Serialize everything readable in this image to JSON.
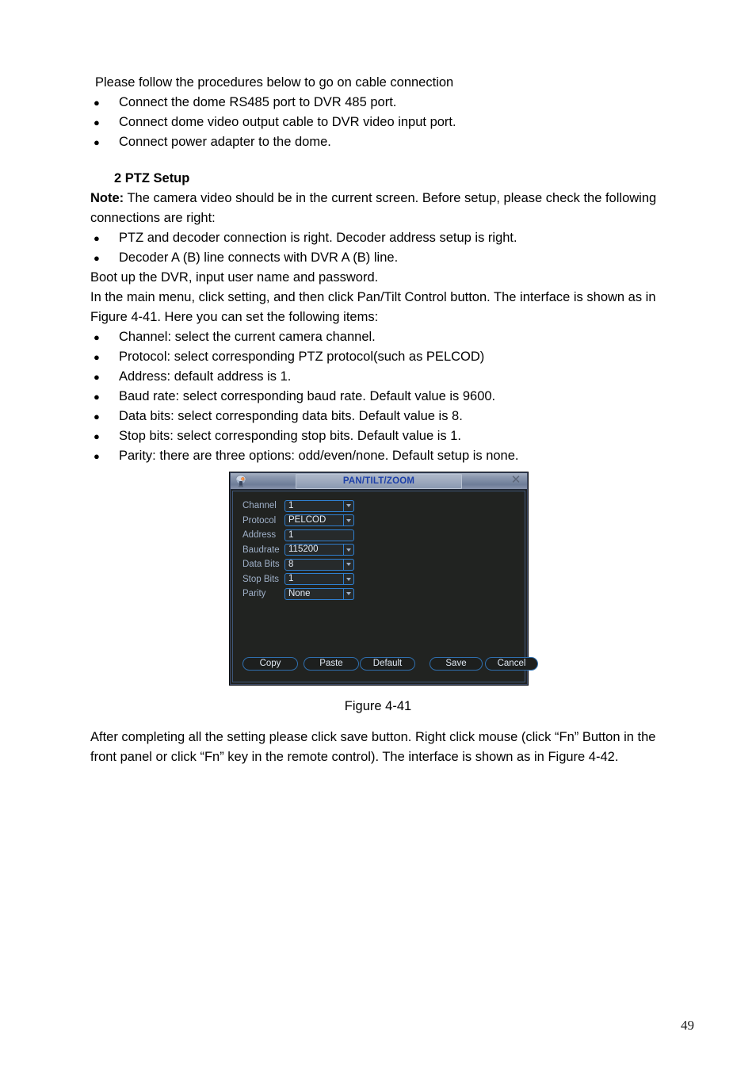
{
  "document": {
    "lead_line": "Please follow the procedures below to go on cable connection",
    "cable_steps": [
      "Connect the dome RS485 port to DVR 485 port.",
      "Connect dome video output cable to DVR video input port.",
      "Connect power adapter to the dome."
    ],
    "section_heading": "2 PTZ Setup",
    "note_label": "Note:",
    "note_text": " The camera video should be in the current screen. Before setup, please check the following connections are right:",
    "check_items": [
      "PTZ and decoder connection is right. Decoder address setup is right.",
      "Decoder A (B) line connects with DVR A (B) line."
    ],
    "boot_line": "Boot up the DVR, input user name and password.",
    "menu_line": "In the main menu, click setting, and then click Pan/Tilt Control button. The interface is shown as in Figure 4-41. Here you can set the following items:",
    "item_list": [
      "Channel: select the current camera channel.",
      "Protocol: select corresponding PTZ protocol(such as PELCOD)",
      "Address: default address is 1.",
      "Baud rate: select corresponding baud rate. Default value is 9600.",
      "Data bits: select corresponding data bits. Default value is 8.",
      "Stop bits: select corresponding stop bits. Default value is 1.",
      "Parity: there are three options: odd/even/none. Default setup is none."
    ],
    "figure_caption": "Figure 4-41",
    "after_text": "After completing all the setting please click save button. Right click mouse (click “Fn” Button in the front panel or click “Fn” key in the remote control). The interface is shown as in Figure 4-42.",
    "page_number": "49"
  },
  "dialog": {
    "title": "PAN/TILT/ZOOM",
    "close_label": "✕",
    "icon_name": "ptz-dome-camera-icon",
    "fields": [
      {
        "label": "Channel",
        "value": "1",
        "control": "dropdown"
      },
      {
        "label": "Protocol",
        "value": "PELCOD",
        "control": "dropdown"
      },
      {
        "label": "Address",
        "value": "1",
        "control": "text"
      },
      {
        "label": "Baudrate",
        "value": "115200",
        "control": "dropdown"
      },
      {
        "label": "Data Bits",
        "value": "8",
        "control": "dropdown"
      },
      {
        "label": "Stop Bits",
        "value": "1",
        "control": "dropdown"
      },
      {
        "label": "Parity",
        "value": "None",
        "control": "dropdown"
      }
    ],
    "buttons": {
      "copy": "Copy",
      "paste": "Paste",
      "default": "Default",
      "save": "Save",
      "cancel": "Cancel"
    },
    "colors": {
      "title_text": "#1c3fa8",
      "label_text": "#9fb0c8",
      "field_border": "#2f7fd0",
      "button_border": "#2f6fae",
      "body_background": "#212321"
    }
  }
}
